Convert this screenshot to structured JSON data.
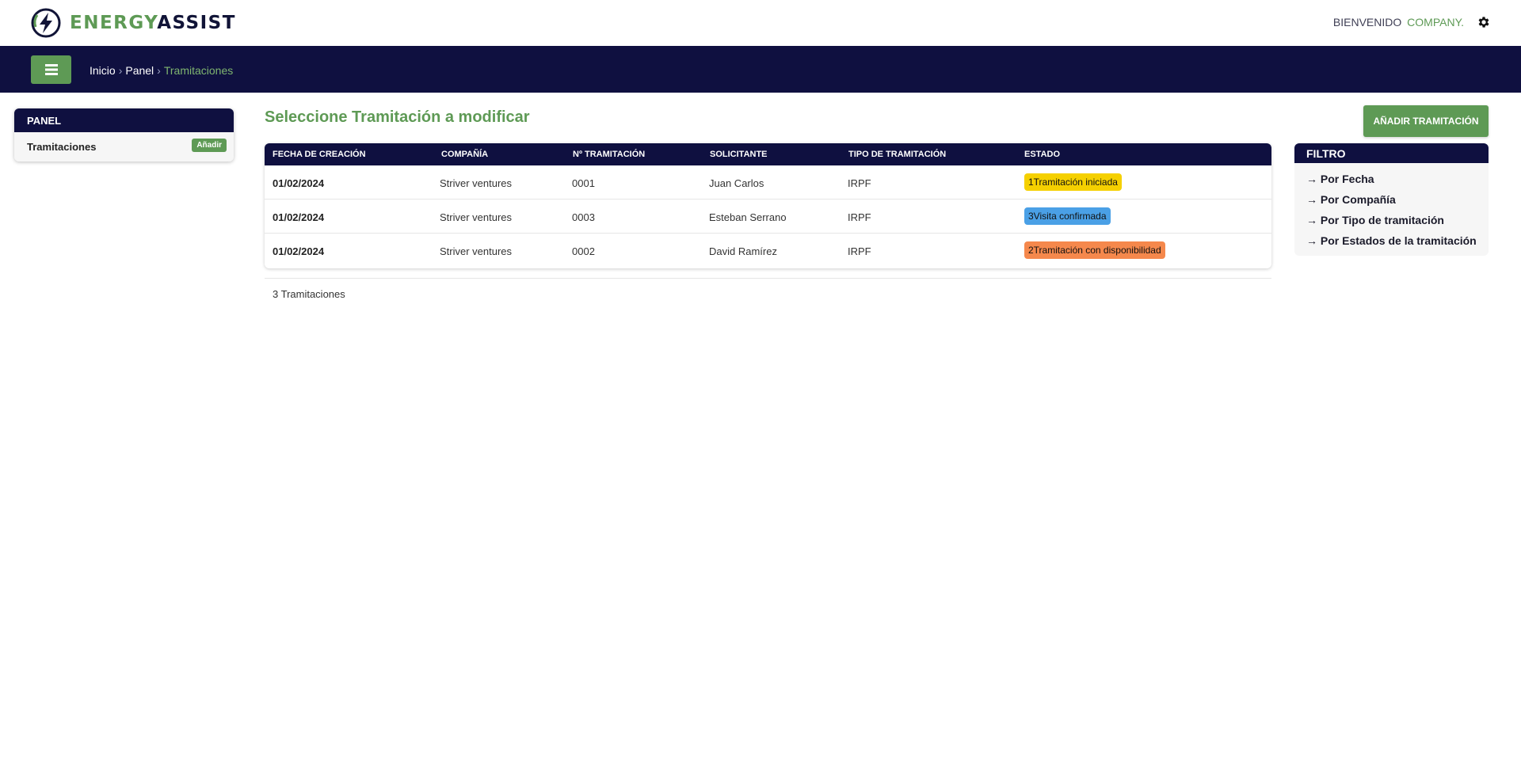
{
  "brand": {
    "part1": "ENERGY",
    "part2": "ASSIST"
  },
  "header": {
    "welcome": "BIENVENIDO",
    "company": "COMPANY."
  },
  "breadcrumb": {
    "home": "Inicio",
    "panel": "Panel",
    "current": "Tramitaciones",
    "separator": "›"
  },
  "sidebar": {
    "title": "PANEL",
    "item_label": "Tramitaciones",
    "add_label": "Añadir"
  },
  "main": {
    "title": "Seleccione Tramitación a modificar",
    "add_button": "AÑADIR TRAMITACIÓN",
    "columns": [
      "FECHA DE CREACIÓN",
      "COMPAÑÍA",
      "Nº TRAMITACIÓN",
      "SOLICITANTE",
      "TIPO DE TRAMITACIÓN",
      "ESTADO"
    ],
    "rows": [
      {
        "fecha": "01/02/2024",
        "compania": "Striver ventures",
        "numero": "0001",
        "solicitante": "Juan Carlos",
        "tipo": "IRPF",
        "estado": "1Tramitación iniciada"
      },
      {
        "fecha": "01/02/2024",
        "compania": "Striver ventures",
        "numero": "0003",
        "solicitante": "Esteban Serrano",
        "tipo": "IRPF",
        "estado": "3Visita confirmada"
      },
      {
        "fecha": "01/02/2024",
        "compania": "Striver ventures",
        "numero": "0002",
        "solicitante": "David Ramírez",
        "tipo": "IRPF",
        "estado": "2Tramitación con disponibilidad"
      }
    ],
    "count": "3 Tramitaciones"
  },
  "filter": {
    "title": "FILTRO",
    "items": [
      "→ Por Fecha",
      "→ Por Compañía",
      "→ Por Tipo de tramitación",
      "→ Por Estados de la tramitación"
    ]
  },
  "colors": {
    "navy": "#0f1040",
    "green": "#5e9a55",
    "status_yellow": "#f5d000",
    "status_blue": "#4aa0e6",
    "status_orange": "#f5884c"
  },
  "icons": {
    "menu": "hamburger-icon",
    "settings": "gear-icon",
    "logo": "lightning-bolt-icon"
  }
}
